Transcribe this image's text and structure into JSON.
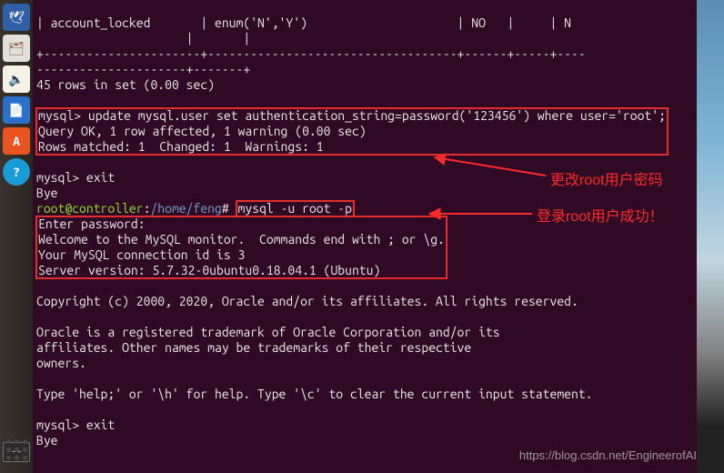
{
  "launcher": {
    "items": [
      {
        "name": "thunderbird",
        "glyph": "🕊",
        "bg": "#2f5fa6"
      },
      {
        "name": "files",
        "glyph": "🗂",
        "bg": "#e2e0da"
      },
      {
        "name": "rhythmbox",
        "glyph": "🔈",
        "bg": "#f7f2e6"
      },
      {
        "name": "writer",
        "glyph": "📄",
        "bg": "#2a6fc9"
      },
      {
        "name": "software",
        "glyph": "A",
        "bg": "#e95420"
      },
      {
        "name": "help",
        "glyph": "?",
        "bg": "#199bd6"
      }
    ]
  },
  "terminal": {
    "line_top1": "| account_locked       | enum('N','Y')                     | NO   |     | N",
    "line_top2": "                     |       |",
    "line_sep1": "+----------------------+-----------------------------------+------+-----+----",
    "line_sep2": "---------------------+-------+",
    "line_rows": "45 rows in set (0.00 sec)",
    "blank": "",
    "upd_prompt": "mysql> ",
    "upd_cmd": "update mysql.user set authentication_string=password('123456') where user='root';",
    "upd_res1": "Query OK, 1 row affected, 1 warning (0.00 sec)",
    "upd_res2": "Rows matched: 1  Changed: 1  Warnings: 1",
    "exit1": "mysql> exit",
    "bye1": "Bye",
    "shell_user": "root@controller",
    "shell_sep1": ":",
    "shell_path": "/home/feng",
    "shell_sep2": "# ",
    "shell_cmd": "mysql -u root -p",
    "enter_pw": "Enter password:",
    "welcome1": "Welcome to the MySQL monitor.  Commands end with ; or \\g.",
    "welcome2": "Your MySQL connection id is 3",
    "welcome3": "Server version: 5.7.32-0ubuntu0.18.04.1 (Ubuntu)",
    "copyright": "Copyright (c) 2000, 2020, Oracle and/or its affiliates. All rights reserved.",
    "trademark1": "Oracle is a registered trademark of Oracle Corporation and/or its",
    "trademark2": "affiliates. Other names may be trademarks of their respective",
    "trademark3": "owners.",
    "help": "Type 'help;' or '\\h' for help. Type '\\c' to clear the current input statement.",
    "exit2": "mysql> exit",
    "bye2": "Bye"
  },
  "annotations": {
    "a1": "更改root用户密码",
    "a2": "登录root用户成功！"
  },
  "watermark": "https://blog.csdn.net/EngineerofAI",
  "termsmall": "--"
}
